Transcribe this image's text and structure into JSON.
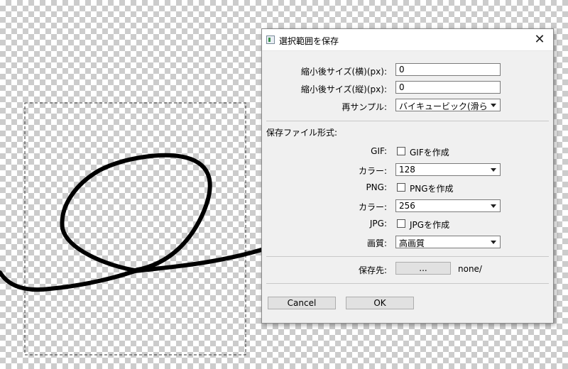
{
  "canvas": {
    "stroke_color": "#000000",
    "selection_border_color": "#333333"
  },
  "dialog": {
    "title": "選択範囲を保存",
    "close_glyph": "✕",
    "width_label": "縮小後サイズ(横)(px):",
    "width_value": "0",
    "height_label": "縮小後サイズ(縦)(px):",
    "height_value": "0",
    "resample_label": "再サンプル:",
    "resample_value": "バイキュービック(滑らかな...",
    "format_section_label": "保存ファイル形式:",
    "gif": {
      "label": "GIF:",
      "checkbox_label": "GIFを作成",
      "checked": false,
      "color_label": "カラー:",
      "color_value": "128"
    },
    "png": {
      "label": "PNG:",
      "checkbox_label": "PNGを作成",
      "checked": false,
      "color_label": "カラー:",
      "color_value": "256"
    },
    "jpg": {
      "label": "JPG:",
      "checkbox_label": "JPGを作成",
      "checked": false,
      "quality_label": "画質:",
      "quality_value": "高画質"
    },
    "dest_label": "保存先:",
    "browse_label": "...",
    "dest_path": "none/",
    "cancel_label": "Cancel",
    "ok_label": "OK"
  }
}
